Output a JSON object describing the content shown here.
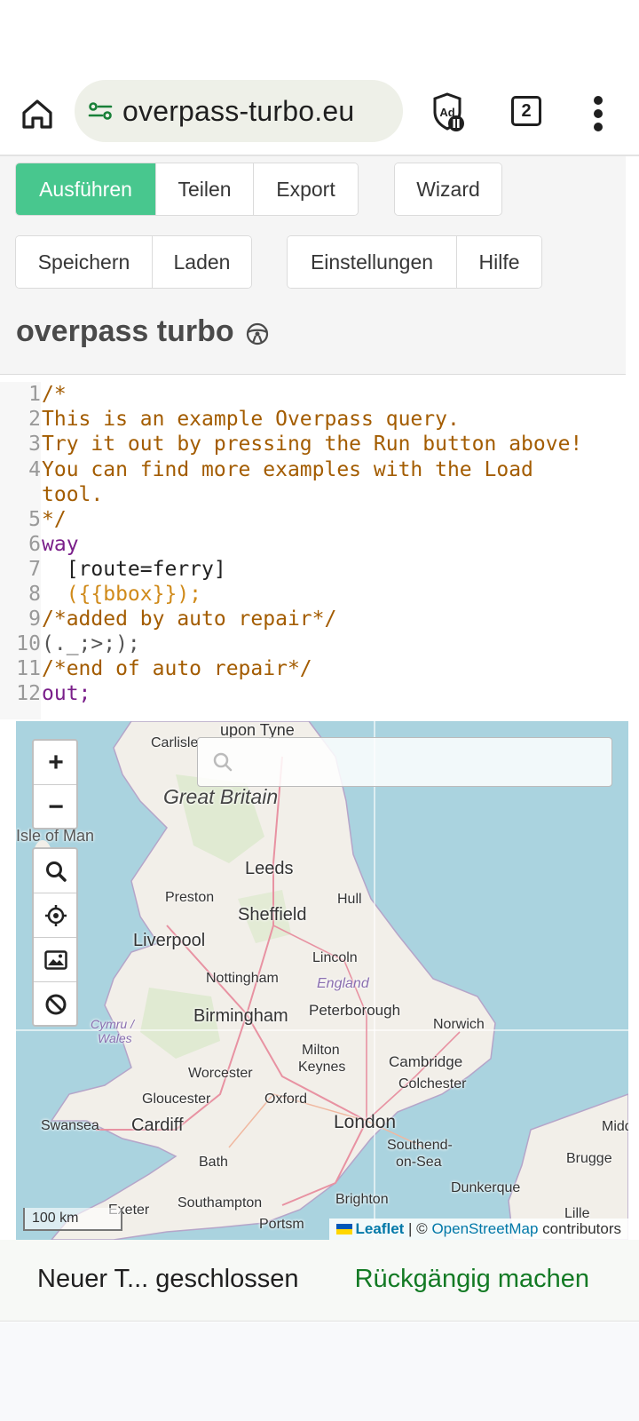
{
  "browser": {
    "url": "overpass-turbo.eu",
    "tab_count": "2"
  },
  "toolbar": {
    "run": "Ausführen",
    "share": "Teilen",
    "export": "Export",
    "wizard": "Wizard",
    "save": "Speichern",
    "load": "Laden",
    "settings": "Einstellungen",
    "help": "Hilfe"
  },
  "app": {
    "title": "overpass turbo"
  },
  "editor": {
    "lines": [
      {
        "n": "1",
        "text": "/*"
      },
      {
        "n": "2",
        "text": "This is an example Overpass query."
      },
      {
        "n": "3",
        "text": "Try it out by pressing the Run button above!"
      },
      {
        "n": "4",
        "text": "You can find more examples with the Load"
      },
      {
        "n": "",
        "text": "tool."
      },
      {
        "n": "5",
        "text": "*/"
      },
      {
        "n": "6",
        "text": "way"
      },
      {
        "n": "7",
        "text": "  [route=ferry]"
      },
      {
        "n": "8",
        "text": "  ({{bbox}});"
      },
      {
        "n": "9",
        "text": "/*added by auto repair*/"
      },
      {
        "n": "10",
        "text": "(._;>;);"
      },
      {
        "n": "11",
        "text": "/*end of auto repair*/"
      },
      {
        "n": "12",
        "text": "out;"
      }
    ]
  },
  "map": {
    "search_placeholder": "",
    "zoom_in": "+",
    "zoom_out": "−",
    "labels": {
      "upon_tyne": "upon Tyne",
      "carlisle": "Carlisle",
      "great_britain": "Great Britain",
      "isle_of_man": "Isle of Man",
      "leeds": "Leeds",
      "preston": "Preston",
      "hull": "Hull",
      "sheffield": "Sheffield",
      "liverpool": "Liverpool",
      "lincoln": "Lincoln",
      "nottingham": "Nottingham",
      "england": "England",
      "birmingham": "Birmingham",
      "peterborough": "Peterborough",
      "norwich": "Norwich",
      "cymru": "Cymru /",
      "wales": "Wales",
      "milton": "Milton",
      "keynes": "Keynes",
      "cambridge": "Cambridge",
      "worcester": "Worcester",
      "colchester": "Colchester",
      "gloucester": "Gloucester",
      "oxford": "Oxford",
      "swansea": "Swansea",
      "cardiff": "Cardiff",
      "london": "London",
      "middel": "Middel",
      "southend": "Southend-",
      "on_sea": "on-Sea",
      "bath": "Bath",
      "brugge": "Brugge",
      "dunkerque": "Dunkerque",
      "exeter": "Exeter",
      "southampton": "Southampton",
      "brighton": "Brighton",
      "portsm": "Portsm",
      "lille": "Lille"
    },
    "scale": "100 km",
    "attribution": {
      "leaflet": "Leaflet",
      "sep": " | © ",
      "osm": "OpenStreetMap",
      "contributors": " contributors"
    }
  },
  "snackbar": {
    "message": "Neuer T... geschlossen",
    "action": "Rückgängig machen"
  },
  "colors": {
    "primary_button": "#48c78e",
    "snack_action": "#137a24",
    "sea": "#aad3df"
  }
}
